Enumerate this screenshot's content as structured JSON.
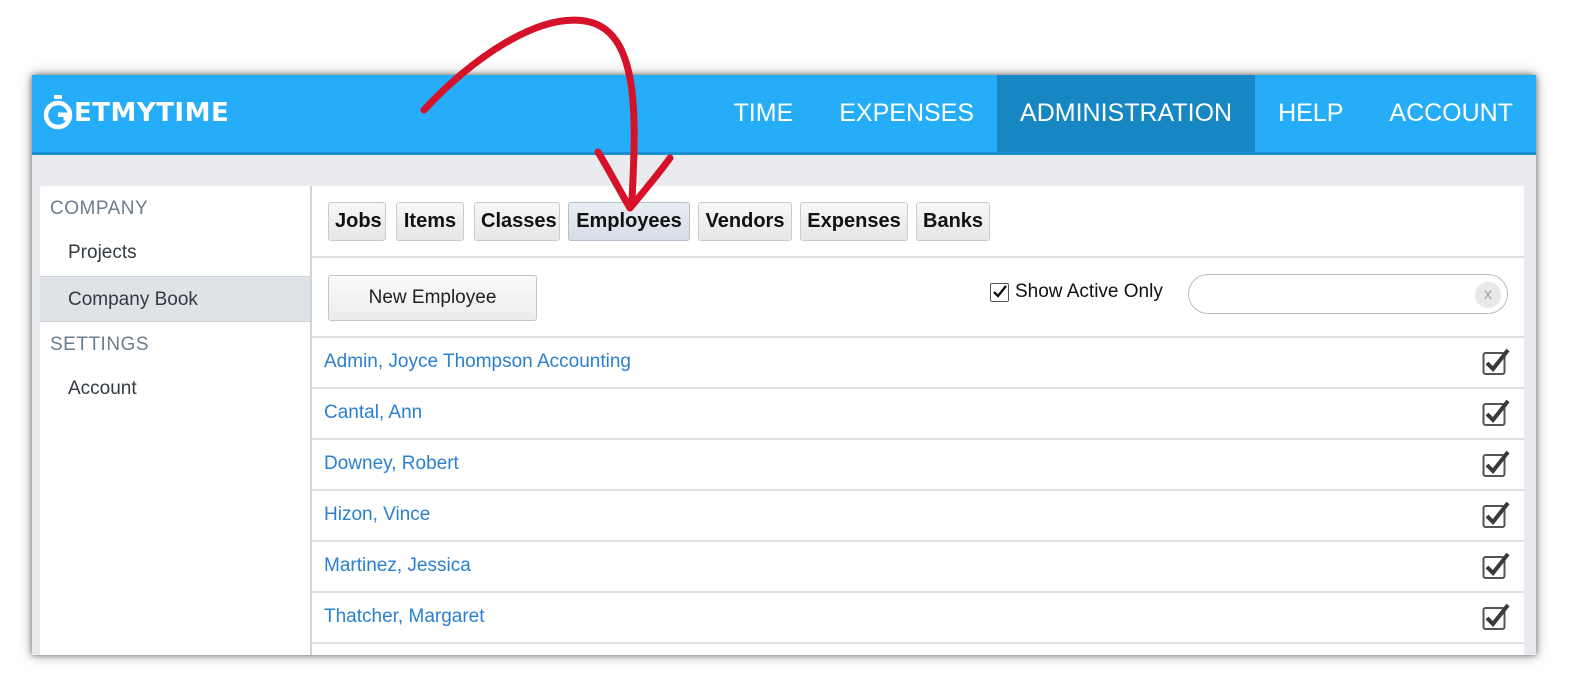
{
  "header": {
    "logo_text": "ETMYTIME",
    "logo_full": "GETMYTIME",
    "nav": [
      {
        "label": "TIME",
        "active": false
      },
      {
        "label": "EXPENSES",
        "active": false
      },
      {
        "label": "ADMINISTRATION",
        "active": true
      },
      {
        "label": "HELP",
        "active": false
      },
      {
        "label": "ACCOUNT",
        "active": false
      }
    ]
  },
  "sidebar": {
    "company_heading": "COMPANY",
    "settings_heading": "SETTINGS",
    "items": [
      {
        "label": "Projects",
        "active": false
      },
      {
        "label": "Company Book",
        "active": true
      },
      {
        "label": "Account",
        "active": false
      }
    ]
  },
  "tabs": [
    {
      "label": "Jobs",
      "active": false
    },
    {
      "label": "Items",
      "active": false
    },
    {
      "label": "Classes",
      "active": false
    },
    {
      "label": "Employees",
      "active": true
    },
    {
      "label": "Vendors",
      "active": false
    },
    {
      "label": "Expenses",
      "active": false
    },
    {
      "label": "Banks",
      "active": false
    }
  ],
  "toolbar": {
    "new_button": "New Employee",
    "show_active_label": "Show Active Only",
    "show_active_checked": true,
    "search_value": "",
    "search_placeholder": "",
    "clear_label": "x"
  },
  "employees": [
    {
      "name": "Admin, Joyce Thompson Accounting",
      "active": true
    },
    {
      "name": "Cantal, Ann",
      "active": true
    },
    {
      "name": "Downey, Robert",
      "active": true
    },
    {
      "name": "Hizon, Vince",
      "active": true
    },
    {
      "name": "Martinez, Jessica",
      "active": true
    },
    {
      "name": "Thatcher, Margaret",
      "active": true
    }
  ],
  "colors": {
    "header_bg": "#25aef7",
    "nav_active_bg": "#1787c3",
    "link": "#2a7fce",
    "annotation_arrow": "#d6122a"
  },
  "icons": {
    "logo": "stopwatch-g-icon",
    "check": "checkmark-icon",
    "clear": "clear-x-icon",
    "annotation": "red-arrow-annotation"
  }
}
